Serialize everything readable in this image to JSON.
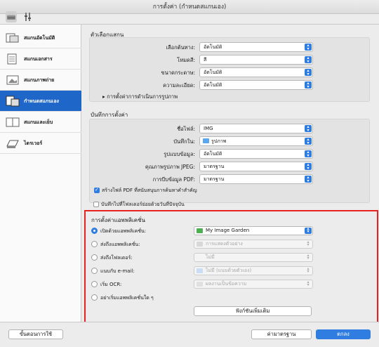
{
  "window": {
    "title": "การตั้งค่า (กำหนดสแกนเอง)"
  },
  "toolbar": {
    "icons": [
      "scanner-icon",
      "tools-icon"
    ]
  },
  "sidebar": {
    "items": [
      {
        "label": "สแกนอัตโนมัติ",
        "icon": "auto-scan-icon",
        "active": false
      },
      {
        "label": "สแกนเอกสาร",
        "icon": "document-scan-icon",
        "active": false
      },
      {
        "label": "สแกนภาพถ่าย",
        "icon": "photo-scan-icon",
        "active": false
      },
      {
        "label": "กำหนดสแกนเอง",
        "icon": "custom-scan-icon",
        "active": true
      },
      {
        "label": "สแกนและเย็บ",
        "icon": "stitch-scan-icon",
        "active": false
      },
      {
        "label": "ไดรเวอร์",
        "icon": "driver-icon",
        "active": false
      }
    ]
  },
  "scan_options": {
    "title": "ตัวเลือกแสกน",
    "fields": [
      {
        "label": "เลือกต้นทาง:",
        "value": "อัตโนมัติ"
      },
      {
        "label": "โหมดสี:",
        "value": "สี"
      },
      {
        "label": "ขนาดกระดาษ:",
        "value": "อัตโนมัติ"
      },
      {
        "label": "ความละเอียด:",
        "value": "อัตโนมัติ"
      }
    ],
    "expander": "การตั้งค่าการดำเนินการรูปภาพ"
  },
  "save_settings": {
    "title": "บันทึกการตั้งค่า",
    "fields": [
      {
        "label": "ชื่อไฟล์:",
        "value": "IMG"
      },
      {
        "label": "บันทึกใน:",
        "value": "รูปภาพ"
      },
      {
        "label": "รูปแบบข้อมูล:",
        "value": "อัตโนมัติ"
      },
      {
        "label": "คุณภาพรูปภาพ JPEG:",
        "value": "มาตรฐาน"
      },
      {
        "label": "การบีบข้อมูล PDF:",
        "value": "มาตรฐาน"
      }
    ],
    "checkboxes": [
      {
        "label": "สร้างไฟล์ PDF ที่สนับสนุนการค้นหาคำสำคัญ",
        "checked": true
      },
      {
        "label": "บันทึกไปที่โฟลเดอร์ย่อยด้วยวันที่ปัจจุบัน",
        "checked": false
      }
    ]
  },
  "app_settings": {
    "title": "การตั้งค่าแอพพลิเคชั่น",
    "options": [
      {
        "label": "เปิดด้วยแอพพลิเคชั่น:",
        "value": "My Image Garden",
        "selected": true,
        "enabled": true
      },
      {
        "label": "ส่งถึงแอพพลิเคชั่น:",
        "value": "การแสดงตัวอย่าง",
        "selected": false,
        "enabled": false
      },
      {
        "label": "ส่งถึงโฟลเดอร์:",
        "value": "ไม่มี",
        "selected": false,
        "enabled": false
      },
      {
        "label": "แนบกับ e-mail:",
        "value": "ไม่มี (แนบด้วยตัวเอง)",
        "selected": false,
        "enabled": false
      },
      {
        "label": "เริ่ม OCR:",
        "value": "ผลงานเป็นข้อความ",
        "selected": false,
        "enabled": false
      },
      {
        "label": "อย่าเริ่มแอพพลิเคชั่นใด ๆ",
        "value": null,
        "selected": false,
        "enabled": true
      }
    ],
    "more_functions": "ฟังก์ชันเพิ่มเติม"
  },
  "footer": {
    "instructions": "ขั้นตอนการใช้",
    "defaults": "ค่ามาตรฐาน",
    "ok": "ตกลง"
  },
  "colors": {
    "accent": "#2f7de1",
    "highlight_border": "#e8231f",
    "sidebar_active": "#1e66c8"
  }
}
